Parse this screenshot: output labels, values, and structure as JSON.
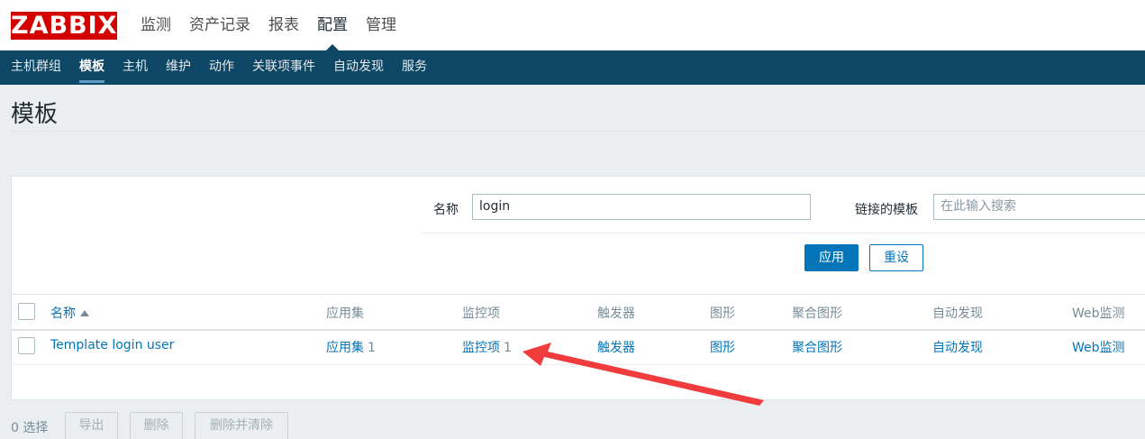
{
  "logo": "ZABBIX",
  "main_nav": [
    {
      "label": "监测"
    },
    {
      "label": "资产记录"
    },
    {
      "label": "报表"
    },
    {
      "label": "配置",
      "active": true
    },
    {
      "label": "管理"
    }
  ],
  "sub_nav": [
    {
      "label": "主机群组"
    },
    {
      "label": "模板",
      "active": true
    },
    {
      "label": "主机"
    },
    {
      "label": "维护"
    },
    {
      "label": "动作"
    },
    {
      "label": "关联项事件"
    },
    {
      "label": "自动发现"
    },
    {
      "label": "服务"
    }
  ],
  "page_title": "模板",
  "filter": {
    "name_label": "名称",
    "name_value": "login",
    "linked_label": "链接的模板",
    "linked_placeholder": "在此输入搜索",
    "apply_label": "应用",
    "reset_label": "重设"
  },
  "table": {
    "headers": {
      "name": "名称",
      "applications": "应用集",
      "items": "监控项",
      "triggers": "触发器",
      "graphs": "图形",
      "screens": "聚合图形",
      "discovery": "自动发现",
      "web": "Web监测"
    },
    "rows": [
      {
        "name": "Template login user",
        "applications": "应用集",
        "applications_count": "1",
        "items": "监控项",
        "items_count": "1",
        "triggers": "触发器",
        "graphs": "图形",
        "screens": "聚合图形",
        "discovery": "自动发现",
        "web": "Web监测"
      }
    ]
  },
  "footer": {
    "selected": "0 选择",
    "export_label": "导出",
    "delete_label": "删除",
    "delete_clear_label": "删除并清除"
  },
  "colors": {
    "brand_red": "#d40000",
    "nav_blue": "#0e4765",
    "link_blue": "#0275b8",
    "annotation_red": "#f03c3c"
  }
}
